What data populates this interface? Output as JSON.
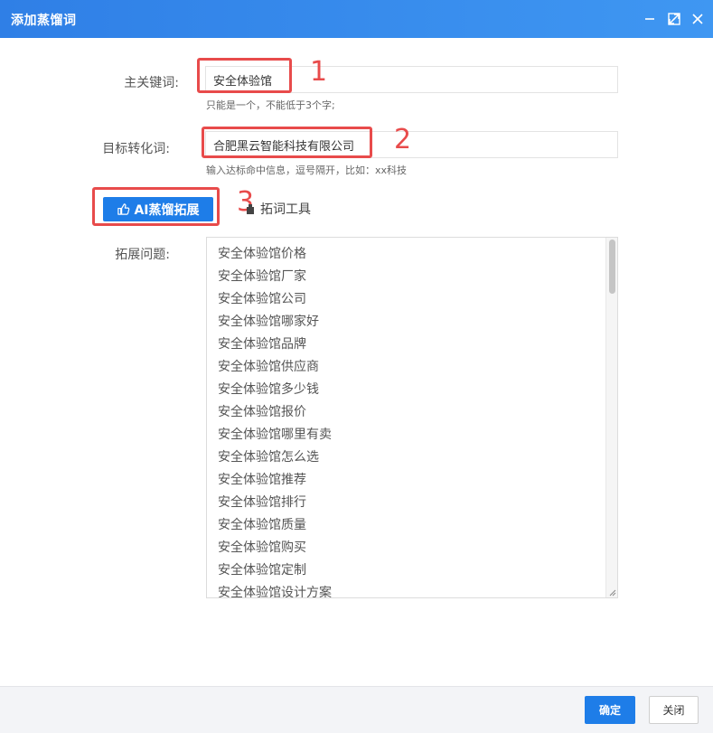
{
  "window": {
    "title": "添加蒸馏词"
  },
  "icons": {
    "minimize": "minimize-icon",
    "maximize": "maximize-icon",
    "close": "close-icon",
    "thumbs_up": "thumbs-up-icon",
    "tool": "tool-icon",
    "resize": "resize-grip-icon"
  },
  "colors": {
    "accent": "#1e7de8",
    "annotation_red": "#e84b4b",
    "titlebar_start": "#2f7fe6",
    "titlebar_end": "#3f97f2"
  },
  "form": {
    "main_keyword": {
      "label": "主关键词:",
      "value": "安全体验馆",
      "hint": "只能是一个，不能低于3个字;"
    },
    "target_word": {
      "label": "目标转化词:",
      "value": "合肥黑云智能科技有限公司",
      "hint": "输入达标命中信息，逗号隔开，比如：xx科技"
    },
    "ai_button_label": "AI蒸馏拓展",
    "tool_label": "拓词工具",
    "expand_label": "拓展问题:",
    "expand_items": [
      "安全体验馆价格",
      "安全体验馆厂家",
      "安全体验馆公司",
      "安全体验馆哪家好",
      "安全体验馆品牌",
      "安全体验馆供应商",
      "安全体验馆多少钱",
      "安全体验馆报价",
      "安全体验馆哪里有卖",
      "安全体验馆怎么选",
      "安全体验馆推荐",
      "安全体验馆排行",
      "安全体验馆质量",
      "安全体验馆购买",
      "安全体验馆定制",
      "安全体验馆设计方案"
    ]
  },
  "annotations": {
    "n1": "1",
    "n2": "2",
    "n3": "3"
  },
  "footer": {
    "ok_label": "确定",
    "close_label": "关闭"
  }
}
